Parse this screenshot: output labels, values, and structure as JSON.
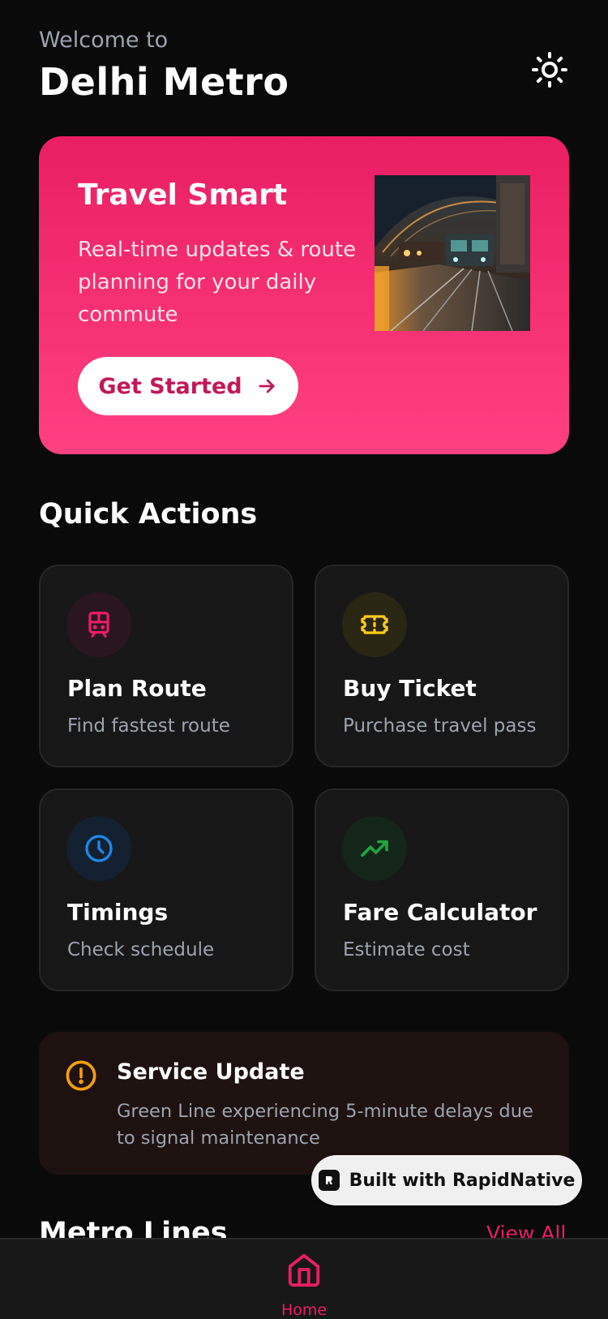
{
  "header": {
    "welcome": "Welcome to",
    "title": "Delhi Metro",
    "theme_icon": "sun-icon"
  },
  "hero": {
    "title": "Travel Smart",
    "subtitle": "Real-time updates & route planning for your daily commute",
    "cta_label": "Get Started",
    "cta_icon": "arrow-right-icon",
    "image": "metro-train-photo",
    "colors": {
      "gradient_top": "#e91e63",
      "gradient_bottom": "#ff4081",
      "cta_text": "#c2185b"
    }
  },
  "quick_actions": {
    "title": "Quick Actions",
    "items": [
      {
        "label": "Plan Route",
        "description": "Find fastest route",
        "icon": "train-icon",
        "color": "#e91e63"
      },
      {
        "label": "Buy Ticket",
        "description": "Purchase travel pass",
        "icon": "ticket-icon",
        "color": "#facc15"
      },
      {
        "label": "Timings",
        "description": "Check schedule",
        "icon": "clock-icon",
        "color": "#1e88e5"
      },
      {
        "label": "Fare Calculator",
        "description": "Estimate cost",
        "icon": "trending-up-icon",
        "color": "#22a33c"
      }
    ]
  },
  "service_update": {
    "title": "Service Update",
    "message": "Green Line experiencing 5-minute delays due to signal maintenance",
    "icon": "alert-circle-icon",
    "color": "#f59e0b"
  },
  "badge": {
    "label": "Built with RapidNative"
  },
  "metro_lines": {
    "title": "Metro Lines",
    "view_all": "View All"
  },
  "tabbar": {
    "home_label": "Home",
    "home_icon": "home-icon",
    "accent": "#e91e63"
  }
}
